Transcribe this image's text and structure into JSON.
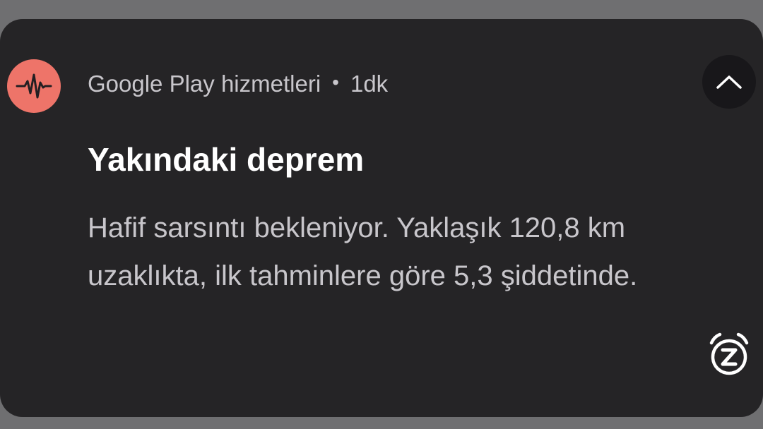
{
  "notification": {
    "app_name": "Google Play hizmetleri",
    "separator": "•",
    "time": "1dk",
    "title": "Yakındaki deprem",
    "body": "Hafif sarsıntı bekleniyor. Yaklaşık 120,8 km uzaklıkta, ilk tahminlere göre 5,3 şiddetinde.",
    "icons": {
      "app": "seismograph-icon",
      "collapse": "chevron-up-icon",
      "snooze": "snooze-alarm-icon"
    },
    "colors": {
      "app_icon_bg": "#ee7469",
      "card_bg": "#252426",
      "title": "#ffffff",
      "secondary_text": "#c8c6cb"
    }
  }
}
